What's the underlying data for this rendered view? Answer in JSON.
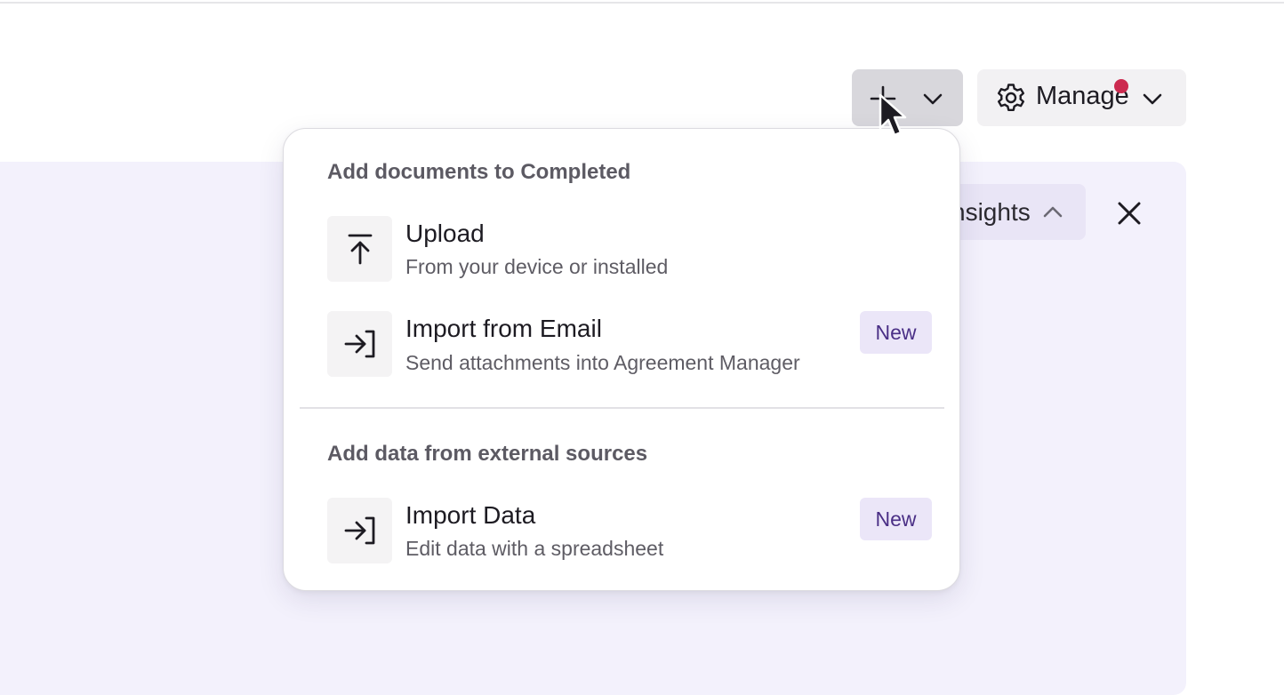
{
  "toolbar": {
    "add_button_icon": "plus-icon",
    "manage_label": "Manage",
    "manage_notification_color": "#cc2a4f"
  },
  "panel": {
    "insights_label": "nsights"
  },
  "menu": {
    "section_documents": {
      "heading": "Add documents to Completed",
      "items": [
        {
          "title": "Upload",
          "description": "From your device or installed",
          "icon": "upload-icon"
        },
        {
          "title": "Import from Email",
          "description": "Send attachments into Agreement Manager",
          "icon": "import-icon",
          "badge": "New"
        }
      ]
    },
    "section_external": {
      "heading": "Add data from external sources",
      "items": [
        {
          "title": "Import Data",
          "description": "Edit data with a spreadsheet",
          "icon": "import-icon",
          "badge": "New"
        }
      ]
    }
  },
  "colors": {
    "panel_background": "#f3f1fc",
    "badge_background": "#ebe6f8",
    "badge_text": "#4a2f86"
  }
}
